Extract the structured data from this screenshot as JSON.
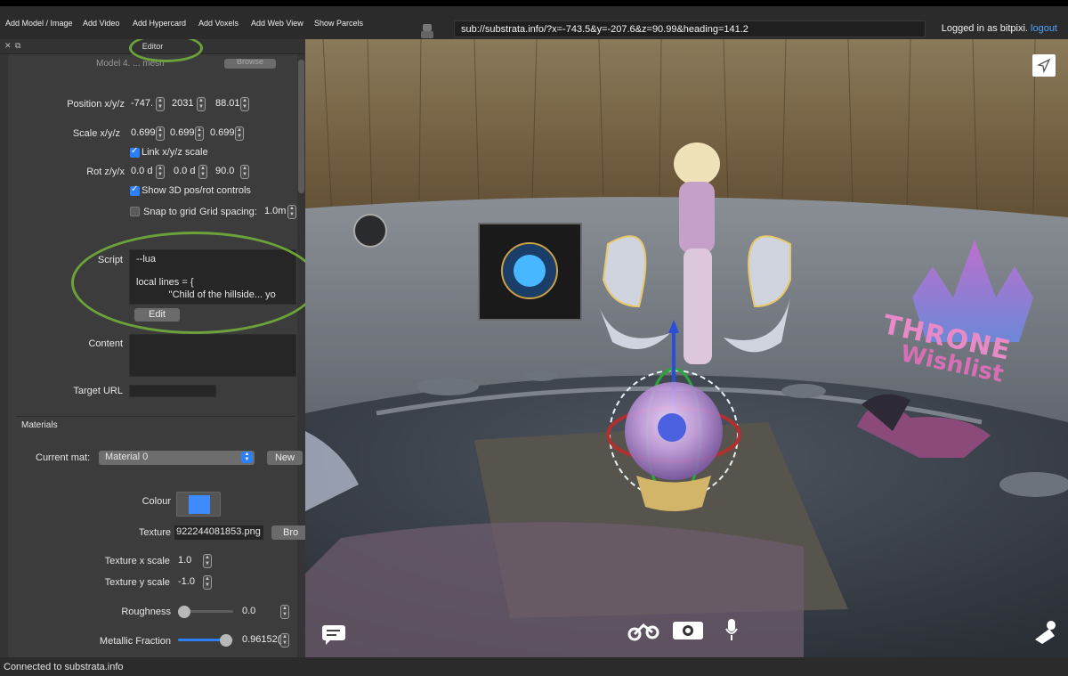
{
  "toolbar": {
    "add_model": "Add Model / Image",
    "add_video": "Add Video",
    "add_hypercard": "Add Hypercard",
    "add_voxels": "Add Voxels",
    "add_web_view": "Add Web View",
    "show_parcels": "Show Parcels",
    "url": "sub://substrata.info/?x=-743.5&y=-207.6&z=90.99&heading=141.2",
    "logged_in_prefix": "Logged in as bitpixi.",
    "logout": "logout"
  },
  "editor": {
    "title": "Editor",
    "model_row_partial": "Model  4.   ...   mesh",
    "browse_partial": "Browse",
    "position_label": "Position x/y/z",
    "position": [
      "-747.",
      "2031",
      "88.01"
    ],
    "scale_label": "Scale x/y/z",
    "scale": [
      "0.699",
      "0.699",
      "0.699"
    ],
    "link_scale": "Link x/y/z scale",
    "rot_label": "Rot z/y/x",
    "rot": [
      "0.0 d",
      "0.0 d",
      "90.0"
    ],
    "show_3d_controls": "Show 3D pos/rot controls",
    "snap_to_grid": "Snap to grid",
    "grid_spacing_label": "Grid spacing:",
    "grid_spacing": "1.0m",
    "script_label": "Script",
    "script_lines": [
      "--lua",
      "",
      "local lines = {",
      "            \"Child of the hillside... yo"
    ],
    "edit_button": "Edit",
    "content_label": "Content",
    "target_url_label": "Target URL",
    "materials_heading": "Materials",
    "current_mat_label": "Current mat:",
    "current_mat": "Material 0",
    "new_button": "New",
    "colour_label": "Colour",
    "colour_value": "#3d8bff",
    "texture_label": "Texture",
    "texture_value": "922244081853.png",
    "texture_browse": "Bro",
    "tex_x_label": "Texture x scale",
    "tex_x": "1.0",
    "tex_y_label": "Texture y scale",
    "tex_y": "-1.0",
    "roughness_label": "Roughness",
    "roughness": "0.0",
    "metallic_label": "Metallic Fraction",
    "metallic": "0.96152("
  },
  "viewport": {
    "sign_line1": "THRONE",
    "sign_line2": "Wishlist"
  },
  "status": {
    "text": "Connected to substrata.info"
  },
  "colors": {
    "annotation": "#6ca23a",
    "checkbox": "#2d7ff9",
    "link": "#4ea4ff"
  }
}
